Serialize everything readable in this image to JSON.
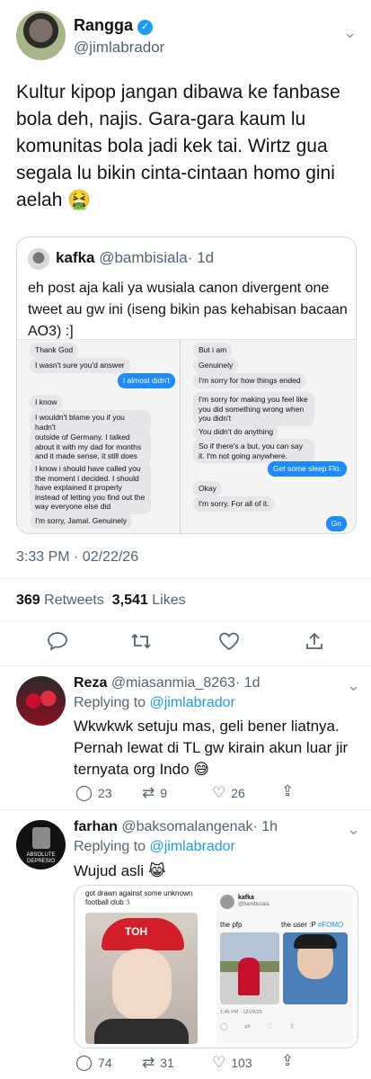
{
  "main_tweet": {
    "name": "Rangga",
    "handle": "@jimlabrador",
    "text": "Kultur kipop jangan dibawa ke fanbase bola deh, najis. Gara-gara kaum lu komunitas bola jadi kek tai. Wirtz gua segala lu bikin cinta-cintaan homo gini aelah 🤮",
    "timestamp": "3:33 PM · 02/22/26",
    "retweets_count": "369",
    "retweets_label": "Retweets",
    "likes_count": "3,541",
    "likes_label": "Likes"
  },
  "quoted_tweet": {
    "name": "kafka",
    "handle": "@bambisiala",
    "age": "· 1d",
    "text": "eh post aja kali ya wusiala canon divergent one tweet au gw ini (iseng bikin pas kehabisan bacaan AO3) :]",
    "chat_left": [
      {
        "text": "Thank God",
        "me": false
      },
      {
        "text": "I wasn't sure you'd answer",
        "me": false
      },
      {
        "text": "I almost didn't",
        "me": true
      },
      {
        "text": "I know",
        "me": false
      },
      {
        "text": "I wouldn't blame you if you hadn't",
        "me": false
      },
      {
        "text": "outside of Germany. I talked about it with my dad for months and it made sense, it still does",
        "me": false
      },
      {
        "text": "I know i should have called you the moment i decided. I should have explained it properly instead of letting you find out the way everyone else did",
        "me": false
      },
      {
        "text": "I'm sorry, Jamal. Genuinely",
        "me": false
      }
    ],
    "chat_right": [
      {
        "text": "But i am",
        "me": false
      },
      {
        "text": "Genuinely",
        "me": false
      },
      {
        "text": "I'm sorry for how things ended",
        "me": false
      },
      {
        "text": "I'm sorry for making you feel like you did something wrong when you didn't",
        "me": false
      },
      {
        "text": "You didn't do anything",
        "me": false
      },
      {
        "text": "So if there's a but, you can say it. I'm not going anywhere.",
        "me": false
      },
      {
        "text": "Get some sleep Flo.",
        "me": true
      },
      {
        "text": "Okay",
        "me": false
      },
      {
        "text": "I'm sorry. For all of it.",
        "me": false
      },
      {
        "text": "Gn",
        "me": true
      }
    ]
  },
  "replies": [
    {
      "name": "Reza",
      "handle": "@miasanmia_8263",
      "age": "· 1d",
      "replying_prefix": "Replying to",
      "replying_to": "@jimlabrador",
      "text": "Wkwkwk setuju mas, geli bener liatnya. Pernah lewat di TL gw kirain akun luar jir ternyata org Indo 😅",
      "replies_count": "23",
      "retweets_count": "9",
      "likes_count": "26"
    },
    {
      "name": "farhan",
      "handle": "@baksomalangenak",
      "age": "· 1h",
      "replying_prefix": "Replying to",
      "replying_to": "@jimlabrador",
      "text": "Wujud asli 😹",
      "replies_count": "74",
      "retweets_count": "31",
      "likes_count": "103",
      "avatar_text": "ABSOLUTE DEPRESIO",
      "media": {
        "left_caption": "got drawn against some unknown football club :\\",
        "cap_text": "TOH",
        "inner_name": "kafka",
        "inner_handle": "@bambisiala",
        "inner_left_label": "the pfp",
        "inner_right_label_prefix": "the user :P ",
        "inner_right_hashtag": "#FOMO",
        "inner_timestamp": "1:45 PM · 12/28/25"
      }
    }
  ],
  "colors": {
    "accent": "#1d9bf0",
    "muted": "#536471",
    "border": "#cfd9de"
  }
}
